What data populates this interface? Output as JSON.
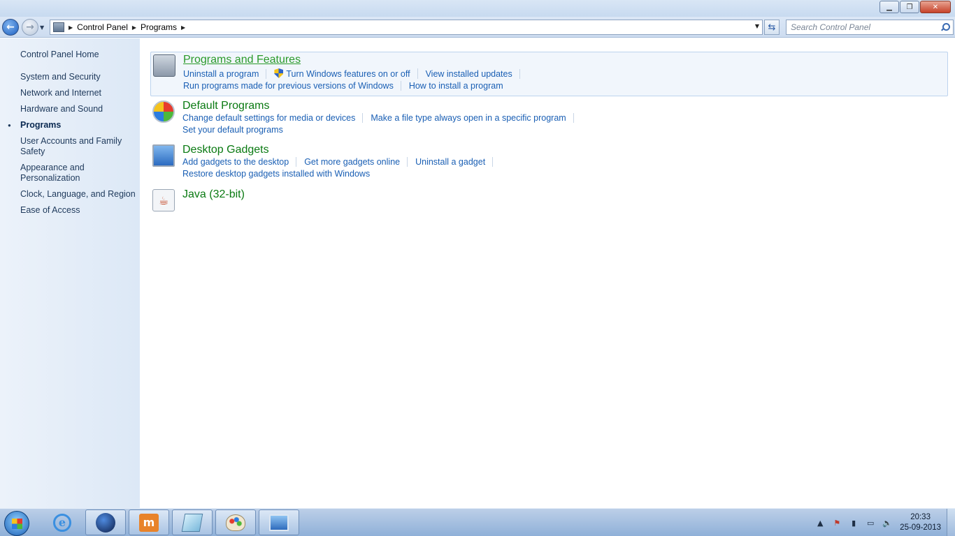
{
  "window": {
    "minimize": "▁",
    "maximize": "❐",
    "close": "✕"
  },
  "nav": {
    "breadcrumbs": [
      "Control Panel",
      "Programs"
    ],
    "search_placeholder": "Search Control Panel"
  },
  "sidebar": {
    "home": "Control Panel Home",
    "items": [
      {
        "label": "System and Security"
      },
      {
        "label": "Network and Internet"
      },
      {
        "label": "Hardware and Sound"
      },
      {
        "label": "Programs",
        "active": true
      },
      {
        "label": "User Accounts and Family Safety"
      },
      {
        "label": "Appearance and Personalization"
      },
      {
        "label": "Clock, Language, and Region"
      },
      {
        "label": "Ease of Access"
      }
    ]
  },
  "categories": [
    {
      "title": "Programs and Features",
      "icon": "programs-icon",
      "links_row1": [
        "Uninstall a program",
        "Turn Windows features on or off",
        "View installed updates"
      ],
      "links_row2": [
        "Run programs made for previous versions of Windows",
        "How to install a program"
      ]
    },
    {
      "title": "Default Programs",
      "icon": "default-programs-icon",
      "links_row1": [
        "Change default settings for media or devices",
        "Make a file type always open in a specific program"
      ],
      "links_row2": [
        "Set your default programs"
      ]
    },
    {
      "title": "Desktop Gadgets",
      "icon": "gadgets-icon",
      "links_row1": [
        "Add gadgets to the desktop",
        "Get more gadgets online",
        "Uninstall a gadget"
      ],
      "links_row2": [
        "Restore desktop gadgets installed with Windows"
      ]
    },
    {
      "title": "Java (32-bit)",
      "icon": "java-icon"
    }
  ],
  "taskbar": {
    "time": "20:33",
    "date": "25-09-2013",
    "apps": [
      "internet-explorer-icon",
      "globe-app-icon",
      "m-app-icon",
      "notepad-icon",
      "paint-icon",
      "control-panel-icon"
    ]
  }
}
